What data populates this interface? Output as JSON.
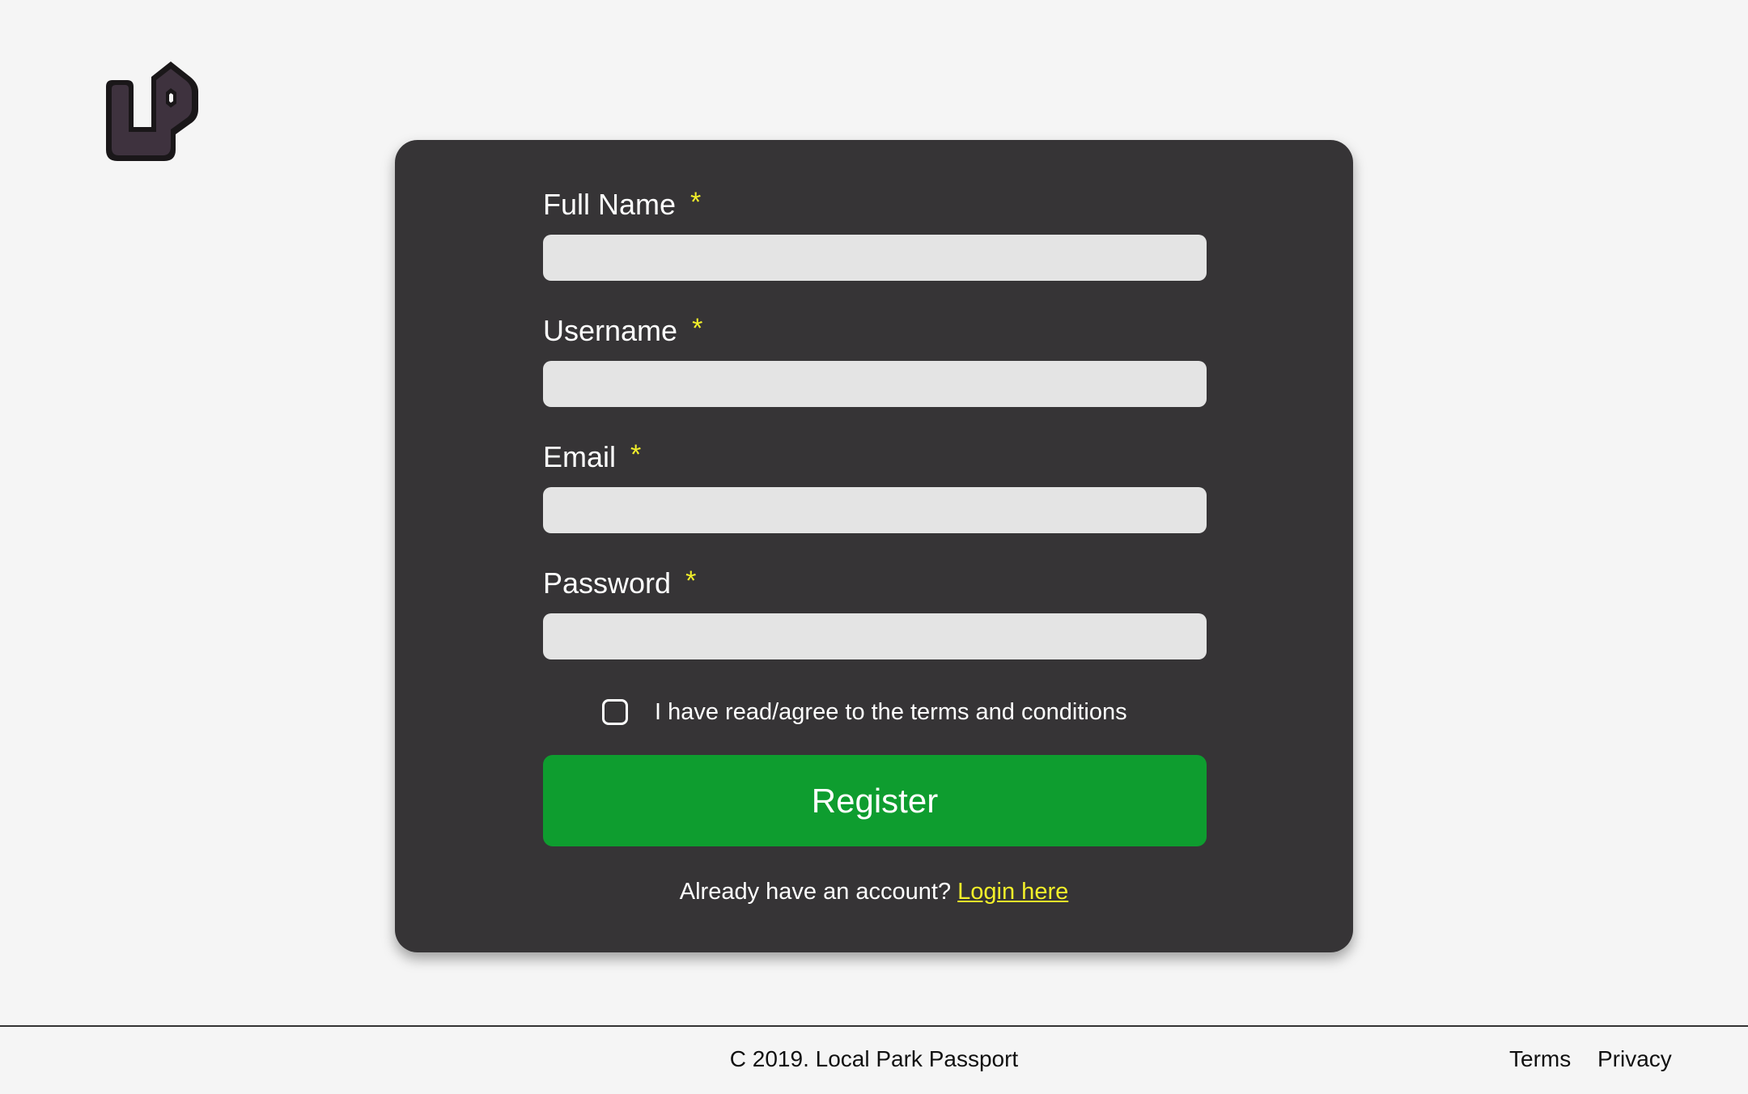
{
  "brand": {
    "logo_icon": "lp-logo-icon"
  },
  "form": {
    "fields": [
      {
        "label": "Full Name",
        "required_mark": "*",
        "value": ""
      },
      {
        "label": "Username",
        "required_mark": "*",
        "value": ""
      },
      {
        "label": "Email",
        "required_mark": "*",
        "value": ""
      },
      {
        "label": "Password",
        "required_mark": "*",
        "value": ""
      }
    ],
    "agree_label": "I have read/agree to the terms and conditions",
    "agree_checked": false,
    "register_label": "Register",
    "login_prompt": "Already have an account?",
    "login_link": "Login here"
  },
  "footer": {
    "copyright": "C  2019. Local Park Passport",
    "links": [
      "Terms",
      "Privacy"
    ]
  },
  "colors": {
    "page_bg": "#f5f5f5",
    "card_bg": "#363436",
    "accent_yellow": "#f2ef2a",
    "register_green": "#0e9d2f",
    "input_bg": "#e4e4e4"
  }
}
